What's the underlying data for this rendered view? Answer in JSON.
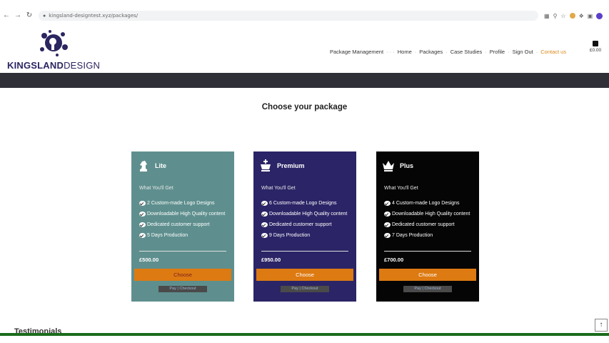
{
  "browser": {
    "url": "kingsland-designtest.xyz/packages/",
    "back_icon": "arrow-left-icon",
    "forward_icon": "arrow-right-icon",
    "reload_icon": "reload-icon"
  },
  "header": {
    "logo_bold": "KINGSLAND",
    "logo_light": "DESIGN",
    "nav": [
      {
        "label": "Package Management"
      },
      {
        "label": "Home"
      },
      {
        "label": "Packages"
      },
      {
        "label": "Case Studies"
      },
      {
        "label": "Profile"
      },
      {
        "label": "Sign Out"
      },
      {
        "label": "Contact us"
      }
    ],
    "cart_amount": "£0.00"
  },
  "main": {
    "title": "Choose your package",
    "packages": [
      {
        "name": "Lite",
        "subtitle": "What You'll Get",
        "features": [
          "2 Custom-made Logo Designs",
          "Downloadable High Quality content",
          "Dedicated customer support",
          "5 Days Production"
        ],
        "price": "£500.00",
        "button": "Choose",
        "pay_label": "Pay | Checkout",
        "color": "#5e8f8e"
      },
      {
        "name": "Premium",
        "subtitle": "What You'll Get",
        "features": [
          "6 Custom-made Logo Designs",
          "Downloadable High Quality content",
          "Dedicated customer support",
          "9 Days Production"
        ],
        "price": "£950.00",
        "button": "Choose",
        "pay_label": "Pay | Checkout",
        "color": "#2b2466"
      },
      {
        "name": "Plus",
        "subtitle": "What You'll Get",
        "features": [
          "4 Custom-made Logo Designs",
          "Downloadable High Quality content",
          "Dedicated customer support",
          "7 Days Production"
        ],
        "price": "£700.00",
        "button": "Choose",
        "pay_label": "Pay | Checkout",
        "color": "#050505"
      }
    ],
    "testimonials_heading": "Testimonials",
    "scroll_top": "↑"
  },
  "colors": {
    "accent": "#dd7a12",
    "banner": "#2f2f37",
    "brand": "#2b2560"
  }
}
